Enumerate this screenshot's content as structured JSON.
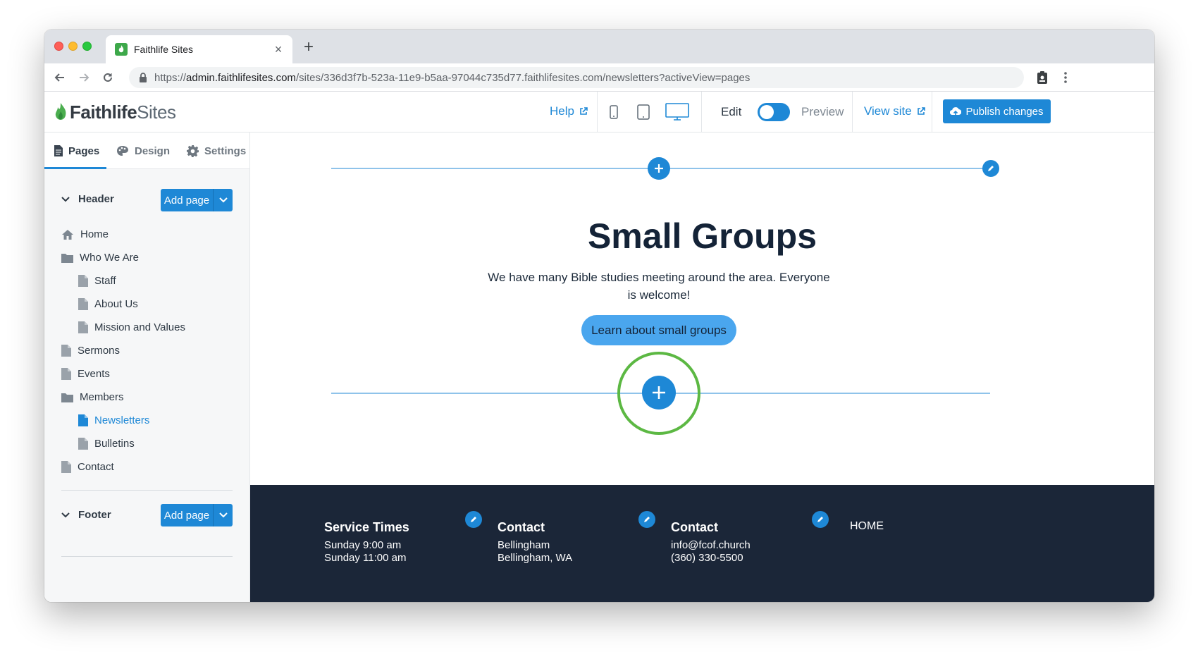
{
  "browser": {
    "tab_title": "Faithlife Sites",
    "tab_close": "×",
    "new_tab": "+",
    "url_prefix": "https://",
    "url_host": "admin.faithlifesites.com",
    "url_path": "/sites/336d3f7b-523a-11e9-b5aa-97044c735d77.faithlifesites.com/newsletters?activeView=pages"
  },
  "header": {
    "logo_bold": "Faithlife",
    "logo_light": "Sites",
    "help": "Help",
    "edit": "Edit",
    "preview": "Preview",
    "view_site": "View site",
    "publish": "Publish changes"
  },
  "sidebar": {
    "tabs": [
      {
        "label": "Pages",
        "icon": "page-icon"
      },
      {
        "label": "Design",
        "icon": "palette-icon"
      },
      {
        "label": "Settings",
        "icon": "gear-icon"
      }
    ],
    "header_section": {
      "title": "Header",
      "add_page": "Add page"
    },
    "footer_section": {
      "title": "Footer",
      "add_page": "Add page"
    },
    "tree": [
      {
        "label": "Home",
        "icon": "home-icon",
        "level": 0
      },
      {
        "label": "Who We Are",
        "icon": "folder-icon",
        "level": 0
      },
      {
        "label": "Staff",
        "icon": "page-icon",
        "level": 1
      },
      {
        "label": "About Us",
        "icon": "page-icon",
        "level": 1
      },
      {
        "label": "Mission and Values",
        "icon": "page-icon",
        "level": 1
      },
      {
        "label": "Sermons",
        "icon": "page-icon",
        "level": 0
      },
      {
        "label": "Events",
        "icon": "page-icon",
        "level": 0
      },
      {
        "label": "Members",
        "icon": "folder-icon",
        "level": 0
      },
      {
        "label": "Newsletters",
        "icon": "page-icon",
        "level": 1,
        "active": true
      },
      {
        "label": "Bulletins",
        "icon": "page-icon",
        "level": 1
      },
      {
        "label": "Contact",
        "icon": "page-icon",
        "level": 0
      }
    ]
  },
  "canvas": {
    "title": "Small Groups",
    "subtext": "We have many Bible studies meeting around the area. Everyone is welcome!",
    "cta": "Learn about small groups"
  },
  "footer": {
    "col1": {
      "title": "Service Times",
      "line1": "Sunday 9:00 am",
      "line2": "Sunday 11:00 am"
    },
    "col2": {
      "title": "Contact",
      "line1": "Bellingham",
      "line2": "Bellingham, WA"
    },
    "col3": {
      "title": "Contact",
      "line1": "info@fcof.church",
      "line2": "(360) 330-5500"
    },
    "nav": "HOME"
  },
  "colors": {
    "accent": "#1e88d6",
    "highlight_ring": "#5cb843",
    "footer_bg": "#1b2638"
  }
}
